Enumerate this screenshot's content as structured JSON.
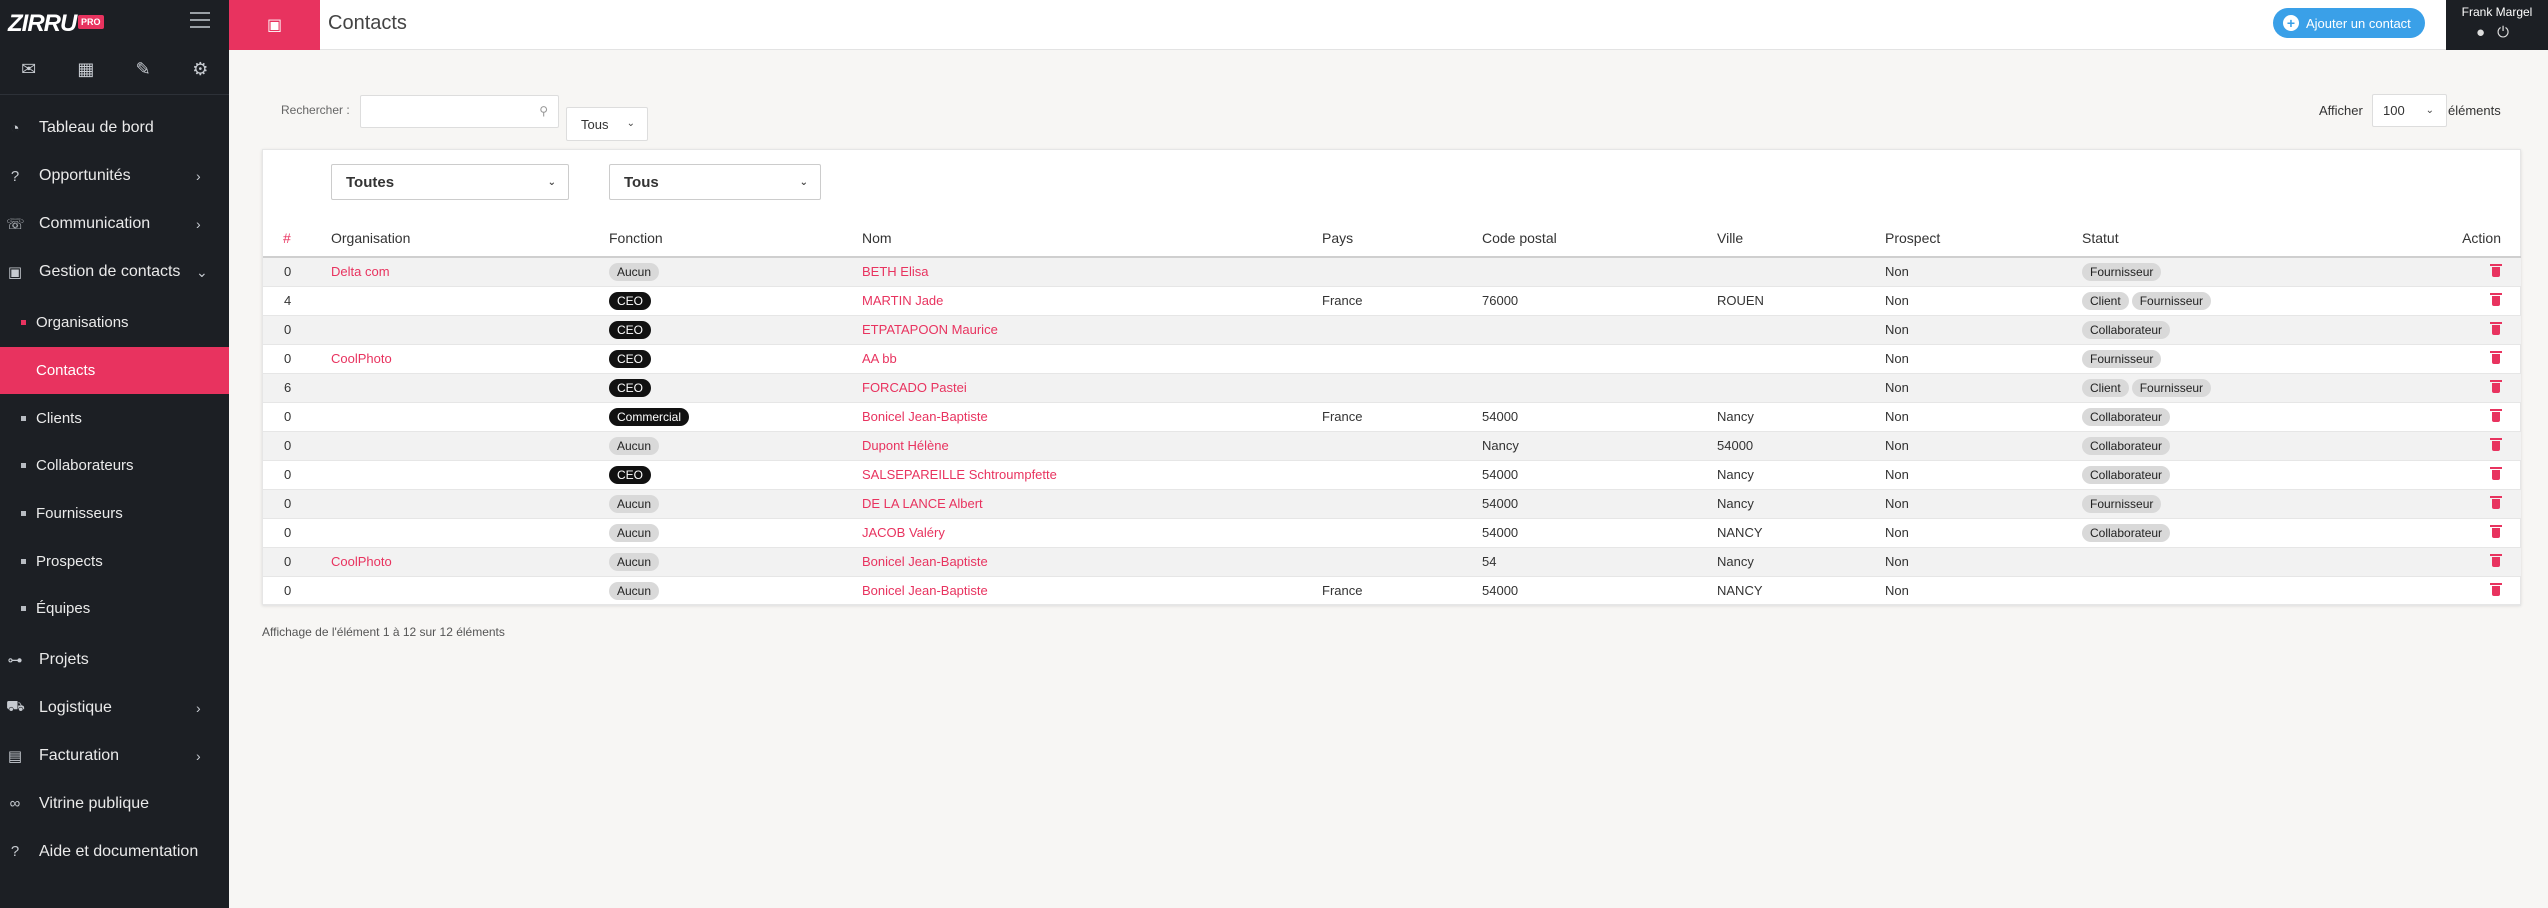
{
  "brand": {
    "logo_text": "ZIRRU",
    "badge": "PRO"
  },
  "quick_icons": [
    "envelope-icon",
    "calendar-icon",
    "pencil-icon",
    "gear-icon"
  ],
  "sidebar": {
    "items": [
      {
        "label": "Tableau de bord",
        "icon": "dashboard-icon",
        "chevron": false
      },
      {
        "label": "Opportunités",
        "icon": "question-circle-icon",
        "chevron": true
      },
      {
        "label": "Communication",
        "icon": "chat-icon",
        "chevron": true
      },
      {
        "label": "Gestion de contacts",
        "icon": "briefcase-icon",
        "chevron": true,
        "expanded": true
      }
    ],
    "submenu": [
      {
        "label": "Organisations",
        "active": false
      },
      {
        "label": "Contacts",
        "active": true
      },
      {
        "label": "Clients",
        "active": false
      },
      {
        "label": "Collaborateurs",
        "active": false
      },
      {
        "label": "Fournisseurs",
        "active": false
      },
      {
        "label": "Prospects",
        "active": false
      },
      {
        "label": "Équipes",
        "active": false
      }
    ],
    "items_after": [
      {
        "label": "Projets",
        "icon": "sitemap-icon",
        "chevron": false
      },
      {
        "label": "Logistique",
        "icon": "dolly-icon",
        "chevron": true
      },
      {
        "label": "Facturation",
        "icon": "invoice-icon",
        "chevron": true
      },
      {
        "label": "Vitrine publique",
        "icon": "link-icon",
        "chevron": false
      },
      {
        "label": "Aide et documentation",
        "icon": "help-icon",
        "chevron": false
      }
    ]
  },
  "header": {
    "title": "Contacts",
    "add_button": "Ajouter un contact",
    "user_name": "Frank Margel"
  },
  "filters": {
    "search_label": "Rechercher :",
    "search_value": "",
    "scope_select": "Tous",
    "show_label": "Afficher",
    "page_size": "100",
    "elements_label": "éléments",
    "org_filter": "Toutes",
    "fonction_filter": "Tous"
  },
  "table": {
    "columns": [
      "#",
      "Organisation",
      "Fonction",
      "Nom",
      "Pays",
      "Code postal",
      "Ville",
      "Prospect",
      "Statut",
      "Action"
    ],
    "rows": [
      {
        "count": "0",
        "org": "Delta com",
        "fonction": "Aucun",
        "fonction_dark": false,
        "nom": "BETH Elisa",
        "pays": "",
        "cp": "",
        "ville": "",
        "prospect": "Non",
        "statut": [
          "Fournisseur"
        ]
      },
      {
        "count": "4",
        "org": "",
        "fonction": "CEO",
        "fonction_dark": true,
        "nom": "MARTIN Jade",
        "pays": "France",
        "cp": "76000",
        "ville": "ROUEN",
        "prospect": "Non",
        "statut": [
          "Client",
          "Fournisseur"
        ]
      },
      {
        "count": "0",
        "org": "",
        "fonction": "CEO",
        "fonction_dark": true,
        "nom": "ETPATAPOON Maurice",
        "pays": "",
        "cp": "",
        "ville": "",
        "prospect": "Non",
        "statut": [
          "Collaborateur"
        ]
      },
      {
        "count": "0",
        "org": "CoolPhoto",
        "fonction": "CEO",
        "fonction_dark": true,
        "nom": "AA bb",
        "pays": "",
        "cp": "",
        "ville": "",
        "prospect": "Non",
        "statut": [
          "Fournisseur"
        ]
      },
      {
        "count": "6",
        "org": "",
        "fonction": "CEO",
        "fonction_dark": true,
        "nom": "FORCADO Pastei",
        "pays": "",
        "cp": "",
        "ville": "",
        "prospect": "Non",
        "statut": [
          "Client",
          "Fournisseur"
        ]
      },
      {
        "count": "0",
        "org": "",
        "fonction": "Commercial",
        "fonction_dark": true,
        "nom": "Bonicel Jean-Baptiste",
        "pays": "France",
        "cp": "54000",
        "ville": "Nancy",
        "prospect": "Non",
        "statut": [
          "Collaborateur"
        ]
      },
      {
        "count": "0",
        "org": "",
        "fonction": "Aucun",
        "fonction_dark": false,
        "nom": "Dupont Hélène",
        "pays": "",
        "cp": "Nancy",
        "ville": "54000",
        "prospect": "Non",
        "statut": [
          "Collaborateur"
        ]
      },
      {
        "count": "0",
        "org": "",
        "fonction": "CEO",
        "fonction_dark": true,
        "nom": "SALSEPAREILLE Schtroumpfette",
        "pays": "",
        "cp": "54000",
        "ville": "Nancy",
        "prospect": "Non",
        "statut": [
          "Collaborateur"
        ]
      },
      {
        "count": "0",
        "org": "",
        "fonction": "Aucun",
        "fonction_dark": false,
        "nom": "DE LA LANCE Albert",
        "pays": "",
        "cp": "54000",
        "ville": "Nancy",
        "prospect": "Non",
        "statut": [
          "Fournisseur"
        ]
      },
      {
        "count": "0",
        "org": "",
        "fonction": "Aucun",
        "fonction_dark": false,
        "nom": "JACOB Valéry",
        "pays": "",
        "cp": "54000",
        "ville": "NANCY",
        "prospect": "Non",
        "statut": [
          "Collaborateur"
        ]
      },
      {
        "count": "0",
        "org": "CoolPhoto",
        "fonction": "Aucun",
        "fonction_dark": false,
        "nom": "Bonicel Jean-Baptiste",
        "pays": "",
        "cp": "54",
        "ville": "Nancy",
        "prospect": "Non",
        "statut": []
      },
      {
        "count": "0",
        "org": "",
        "fonction": "Aucun",
        "fonction_dark": false,
        "nom": "Bonicel Jean-Baptiste",
        "pays": "France",
        "cp": "54000",
        "ville": "NANCY",
        "prospect": "Non",
        "statut": []
      }
    ]
  },
  "pager_info": "Affichage de l'élément 1 à 12 sur 12 éléments",
  "colors": {
    "accent": "#e8335f",
    "sidebar_bg": "#1c1f24",
    "button_blue": "#3aa0e8"
  }
}
